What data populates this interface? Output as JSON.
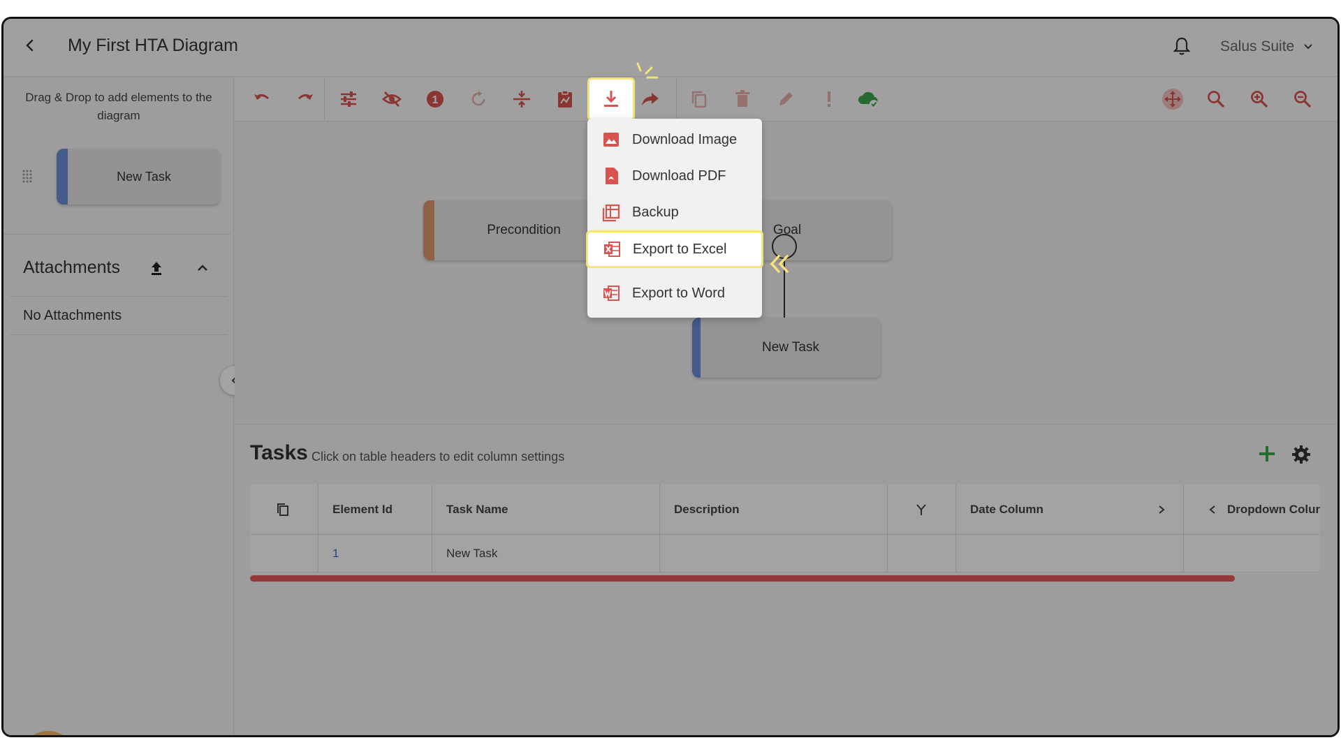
{
  "header": {
    "title": "My First HTA Diagram",
    "account_label": "Salus Suite"
  },
  "sidebar": {
    "drag_hint": "Drag & Drop to add elements to the diagram",
    "palette_item": "New Task",
    "attachments_title": "Attachments",
    "no_attachments": "No Attachments"
  },
  "canvas": {
    "nodes": {
      "precondition": "Precondition",
      "goal": "Goal",
      "new_task": "New Task"
    }
  },
  "download_menu": {
    "items": [
      {
        "label": "Download Image",
        "icon": "image-icon"
      },
      {
        "label": "Download PDF",
        "icon": "pdf-icon"
      },
      {
        "label": "Backup",
        "icon": "backup-icon"
      },
      {
        "label": "Export to Excel",
        "icon": "excel-icon"
      },
      {
        "label": "Export to Word",
        "icon": "word-icon"
      }
    ]
  },
  "tasks": {
    "title": "Tasks",
    "hint": "Click on table headers to edit column settings",
    "columns": [
      "Element Id",
      "Task Name",
      "Description",
      "Date Column",
      "Dropdown Colur"
    ],
    "rows": [
      {
        "element_id": "1",
        "task_name": "New Task",
        "description": "",
        "date": "",
        "dropdown": ""
      }
    ]
  },
  "colors": {
    "accent_red": "#d9534f",
    "highlight_yellow": "#f5e27a",
    "task_blue": "#6b8dd6",
    "precondition_orange": "#e09a70",
    "success_green": "#3aa64a",
    "help_orange": "#f3b45d"
  }
}
